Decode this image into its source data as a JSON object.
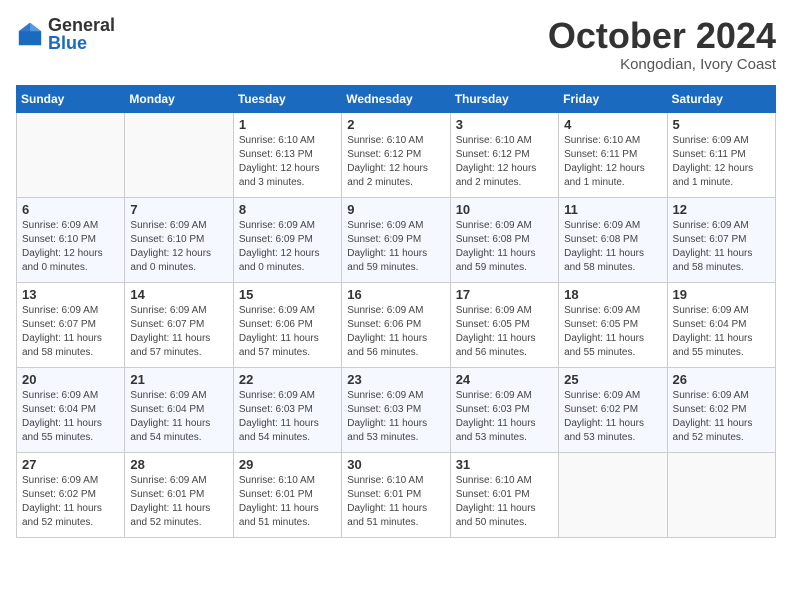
{
  "logo": {
    "general": "General",
    "blue": "Blue"
  },
  "header": {
    "month": "October 2024",
    "location": "Kongodian, Ivory Coast"
  },
  "weekdays": [
    "Sunday",
    "Monday",
    "Tuesday",
    "Wednesday",
    "Thursday",
    "Friday",
    "Saturday"
  ],
  "weeks": [
    [
      {
        "day": "",
        "info": ""
      },
      {
        "day": "",
        "info": ""
      },
      {
        "day": "1",
        "info": "Sunrise: 6:10 AM\nSunset: 6:13 PM\nDaylight: 12 hours and 3 minutes."
      },
      {
        "day": "2",
        "info": "Sunrise: 6:10 AM\nSunset: 6:12 PM\nDaylight: 12 hours and 2 minutes."
      },
      {
        "day": "3",
        "info": "Sunrise: 6:10 AM\nSunset: 6:12 PM\nDaylight: 12 hours and 2 minutes."
      },
      {
        "day": "4",
        "info": "Sunrise: 6:10 AM\nSunset: 6:11 PM\nDaylight: 12 hours and 1 minute."
      },
      {
        "day": "5",
        "info": "Sunrise: 6:09 AM\nSunset: 6:11 PM\nDaylight: 12 hours and 1 minute."
      }
    ],
    [
      {
        "day": "6",
        "info": "Sunrise: 6:09 AM\nSunset: 6:10 PM\nDaylight: 12 hours and 0 minutes."
      },
      {
        "day": "7",
        "info": "Sunrise: 6:09 AM\nSunset: 6:10 PM\nDaylight: 12 hours and 0 minutes."
      },
      {
        "day": "8",
        "info": "Sunrise: 6:09 AM\nSunset: 6:09 PM\nDaylight: 12 hours and 0 minutes."
      },
      {
        "day": "9",
        "info": "Sunrise: 6:09 AM\nSunset: 6:09 PM\nDaylight: 11 hours and 59 minutes."
      },
      {
        "day": "10",
        "info": "Sunrise: 6:09 AM\nSunset: 6:08 PM\nDaylight: 11 hours and 59 minutes."
      },
      {
        "day": "11",
        "info": "Sunrise: 6:09 AM\nSunset: 6:08 PM\nDaylight: 11 hours and 58 minutes."
      },
      {
        "day": "12",
        "info": "Sunrise: 6:09 AM\nSunset: 6:07 PM\nDaylight: 11 hours and 58 minutes."
      }
    ],
    [
      {
        "day": "13",
        "info": "Sunrise: 6:09 AM\nSunset: 6:07 PM\nDaylight: 11 hours and 58 minutes."
      },
      {
        "day": "14",
        "info": "Sunrise: 6:09 AM\nSunset: 6:07 PM\nDaylight: 11 hours and 57 minutes."
      },
      {
        "day": "15",
        "info": "Sunrise: 6:09 AM\nSunset: 6:06 PM\nDaylight: 11 hours and 57 minutes."
      },
      {
        "day": "16",
        "info": "Sunrise: 6:09 AM\nSunset: 6:06 PM\nDaylight: 11 hours and 56 minutes."
      },
      {
        "day": "17",
        "info": "Sunrise: 6:09 AM\nSunset: 6:05 PM\nDaylight: 11 hours and 56 minutes."
      },
      {
        "day": "18",
        "info": "Sunrise: 6:09 AM\nSunset: 6:05 PM\nDaylight: 11 hours and 55 minutes."
      },
      {
        "day": "19",
        "info": "Sunrise: 6:09 AM\nSunset: 6:04 PM\nDaylight: 11 hours and 55 minutes."
      }
    ],
    [
      {
        "day": "20",
        "info": "Sunrise: 6:09 AM\nSunset: 6:04 PM\nDaylight: 11 hours and 55 minutes."
      },
      {
        "day": "21",
        "info": "Sunrise: 6:09 AM\nSunset: 6:04 PM\nDaylight: 11 hours and 54 minutes."
      },
      {
        "day": "22",
        "info": "Sunrise: 6:09 AM\nSunset: 6:03 PM\nDaylight: 11 hours and 54 minutes."
      },
      {
        "day": "23",
        "info": "Sunrise: 6:09 AM\nSunset: 6:03 PM\nDaylight: 11 hours and 53 minutes."
      },
      {
        "day": "24",
        "info": "Sunrise: 6:09 AM\nSunset: 6:03 PM\nDaylight: 11 hours and 53 minutes."
      },
      {
        "day": "25",
        "info": "Sunrise: 6:09 AM\nSunset: 6:02 PM\nDaylight: 11 hours and 53 minutes."
      },
      {
        "day": "26",
        "info": "Sunrise: 6:09 AM\nSunset: 6:02 PM\nDaylight: 11 hours and 52 minutes."
      }
    ],
    [
      {
        "day": "27",
        "info": "Sunrise: 6:09 AM\nSunset: 6:02 PM\nDaylight: 11 hours and 52 minutes."
      },
      {
        "day": "28",
        "info": "Sunrise: 6:09 AM\nSunset: 6:01 PM\nDaylight: 11 hours and 52 minutes."
      },
      {
        "day": "29",
        "info": "Sunrise: 6:10 AM\nSunset: 6:01 PM\nDaylight: 11 hours and 51 minutes."
      },
      {
        "day": "30",
        "info": "Sunrise: 6:10 AM\nSunset: 6:01 PM\nDaylight: 11 hours and 51 minutes."
      },
      {
        "day": "31",
        "info": "Sunrise: 6:10 AM\nSunset: 6:01 PM\nDaylight: 11 hours and 50 minutes."
      },
      {
        "day": "",
        "info": ""
      },
      {
        "day": "",
        "info": ""
      }
    ]
  ]
}
